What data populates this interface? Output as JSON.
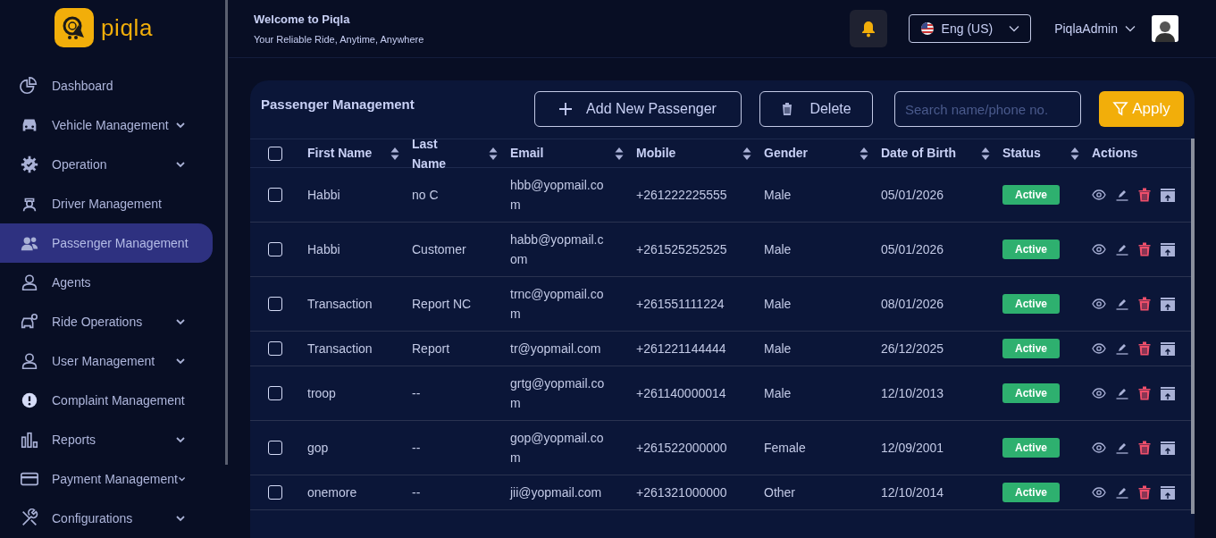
{
  "brand": {
    "name": "piqla"
  },
  "sidebar": {
    "items": [
      {
        "label": "Dashboard",
        "selected": false,
        "expandable": false
      },
      {
        "label": "Vehicle Management",
        "selected": false,
        "expandable": true
      },
      {
        "label": "Operation",
        "selected": false,
        "expandable": true
      },
      {
        "label": "Driver Management",
        "selected": false,
        "expandable": false
      },
      {
        "label": "Passenger Management",
        "selected": true,
        "expandable": false
      },
      {
        "label": "Agents",
        "selected": false,
        "expandable": false
      },
      {
        "label": "Ride Operations",
        "selected": false,
        "expandable": true
      },
      {
        "label": "User Management",
        "selected": false,
        "expandable": true
      },
      {
        "label": "Complaint Management",
        "selected": false,
        "expandable": false
      },
      {
        "label": "Reports",
        "selected": false,
        "expandable": true
      },
      {
        "label": "Payment Management",
        "selected": false,
        "expandable": true
      },
      {
        "label": "Configurations",
        "selected": false,
        "expandable": true
      }
    ]
  },
  "header": {
    "title": "Welcome to Piqla",
    "subtitle": "Your Reliable Ride, Anytime, Anywhere",
    "language": "Eng (US)",
    "user": "PiqlaAdmin"
  },
  "panel": {
    "title": "Passenger Management",
    "add_button": "Add New Passenger",
    "delete_button": "Delete",
    "search": {
      "placeholder": "Search name/phone no."
    },
    "apply_button": "Apply"
  },
  "table": {
    "all_checked": false,
    "columns": [
      {
        "label": "First Name",
        "sortable": true
      },
      {
        "label": "Last Name",
        "sortable": true
      },
      {
        "label": "Email",
        "sortable": true
      },
      {
        "label": "Mobile",
        "sortable": true
      },
      {
        "label": "Gender",
        "sortable": true
      },
      {
        "label": "Date of Birth",
        "sortable": true
      },
      {
        "label": "Status",
        "sortable": true
      },
      {
        "label": "Actions",
        "sortable": false
      }
    ],
    "rows": [
      {
        "checked": false,
        "cells": [
          "Habbi",
          "no C",
          "hbb@yopmail.com",
          "+261222225555",
          "Male",
          "05/01/2026"
        ],
        "status": "Active"
      },
      {
        "checked": false,
        "cells": [
          "Habbi",
          "Customer",
          "habb@yopmail.com",
          "+261525252525",
          "Male",
          "05/01/2026"
        ],
        "status": "Active"
      },
      {
        "checked": false,
        "cells": [
          "Transaction",
          "Report NC",
          "trnc@yopmail.com",
          "+261551111224",
          "Male",
          "08/01/2026"
        ],
        "status": "Active"
      },
      {
        "checked": false,
        "cells": [
          "Transaction",
          "Report",
          "tr@yopmail.com",
          "+261221144444",
          "Male",
          "26/12/2025"
        ],
        "status": "Active"
      },
      {
        "checked": false,
        "cells": [
          "troop",
          "--",
          "grtg@yopmail.com",
          "+261140000014",
          "Male",
          "12/10/2013"
        ],
        "status": "Active"
      },
      {
        "checked": false,
        "cells": [
          "gop",
          "--",
          "gop@yopmail.com",
          "+261522000000",
          "Female",
          "12/09/2001"
        ],
        "status": "Active"
      },
      {
        "checked": false,
        "cells": [
          "onemore",
          "--",
          "jii@yopmail.com",
          "+261321000000",
          "Other",
          "12/10/2014"
        ],
        "status": "Active"
      }
    ]
  }
}
